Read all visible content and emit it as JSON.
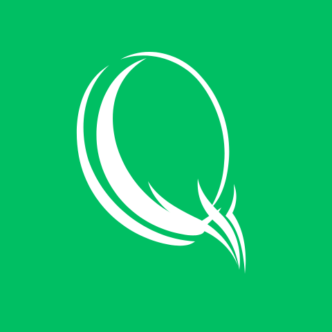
{
  "app_icon": {
    "logo_icon": "q-logo-icon",
    "background_color": "#00BF63",
    "logo_color": "#FFFFFF"
  }
}
